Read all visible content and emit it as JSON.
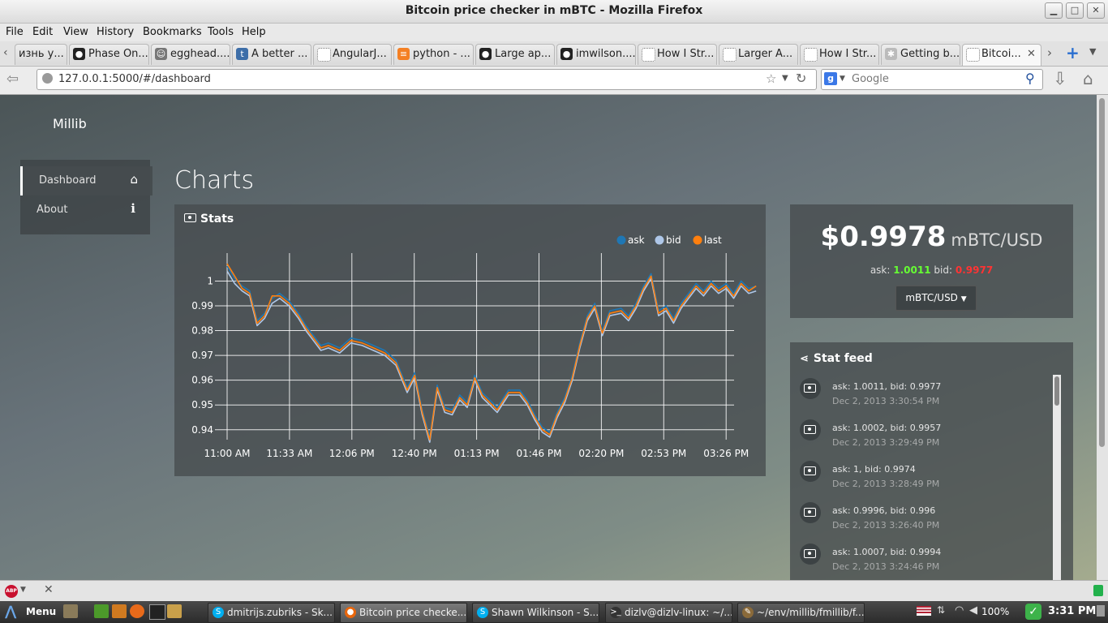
{
  "window": {
    "title": "Bitcoin price checker in mBTC - Mozilla Firefox"
  },
  "menu": [
    "File",
    "Edit",
    "View",
    "History",
    "Bookmarks",
    "Tools",
    "Help"
  ],
  "tabs": [
    {
      "label": "изнь у...",
      "icon": "generic-page-icon"
    },
    {
      "label": "Phase On...",
      "icon": "github-icon"
    },
    {
      "label": "egghead....",
      "icon": "egghead-icon"
    },
    {
      "label": "A better ...",
      "icon": "tumblr-icon"
    },
    {
      "label": "AngularJ...",
      "icon": "generic-page-icon"
    },
    {
      "label": "python - ...",
      "icon": "stackoverflow-icon"
    },
    {
      "label": "Large ap...",
      "icon": "github-icon"
    },
    {
      "label": "imwilson....",
      "icon": "github-icon"
    },
    {
      "label": "How I Str...",
      "icon": "generic-page-icon"
    },
    {
      "label": "Larger A...",
      "icon": "generic-page-icon"
    },
    {
      "label": "How I Str...",
      "icon": "generic-page-icon"
    },
    {
      "label": "Getting b...",
      "icon": "loading-icon"
    },
    {
      "label": "Bitcoi...",
      "icon": "generic-page-icon",
      "active": true
    }
  ],
  "nav": {
    "url": "127.0.0.1:5000/#/dashboard",
    "search_placeholder": "Google"
  },
  "app": {
    "brand": "Millib",
    "nav": [
      {
        "label": "Dashboard",
        "icon": "home-icon",
        "active": true
      },
      {
        "label": "About",
        "icon": "info-icon"
      }
    ],
    "page_title": "Charts",
    "stats_title": "Stats",
    "price": "$0.9978",
    "price_unit": "mBTC/USD",
    "ask_label": "ask:",
    "ask_value": "1.0011",
    "bid_label": "bid:",
    "bid_value": "0.9977",
    "currency_button": "mBTC/USD",
    "feed_title": "Stat feed",
    "feed": [
      {
        "text": "ask: 1.0011, bid: 0.9977",
        "time": "Dec 2, 2013 3:30:54 PM"
      },
      {
        "text": "ask: 1.0002, bid: 0.9957",
        "time": "Dec 2, 2013 3:29:49 PM"
      },
      {
        "text": "ask: 1, bid: 0.9974",
        "time": "Dec 2, 2013 3:28:49 PM"
      },
      {
        "text": "ask: 0.9996, bid: 0.996",
        "time": "Dec 2, 2013 3:26:40 PM"
      },
      {
        "text": "ask: 1.0007, bid: 0.9994",
        "time": "Dec 2, 2013 3:24:46 PM"
      }
    ],
    "colors": {
      "ask": "#1f77b4",
      "bid": "#aec7e8",
      "last": "#ff7f0e",
      "ask_value": "#66ff33",
      "bid_value": "#ff3333"
    }
  },
  "chart_data": {
    "type": "line",
    "title": "",
    "legend": "top-right",
    "grid": true,
    "x_ticks": [
      "11:00 AM",
      "11:33 AM",
      "12:06 PM",
      "12:40 PM",
      "01:13 PM",
      "01:46 PM",
      "02:20 PM",
      "02:53 PM",
      "03:26 PM"
    ],
    "y_ticks": [
      0.94,
      0.95,
      0.96,
      0.97,
      0.98,
      0.99,
      1
    ],
    "ylim": [
      0.936,
      1.008
    ],
    "x_minutes_from_first_tick": [
      0,
      4,
      8,
      12,
      16,
      20,
      24,
      28,
      33,
      38,
      42,
      46,
      50,
      54,
      60,
      66,
      72,
      78,
      84,
      90,
      96,
      100,
      104,
      108,
      112,
      116,
      120,
      124,
      128,
      132,
      136,
      140,
      144,
      150,
      156,
      160,
      164,
      168,
      172,
      176,
      180,
      184,
      188,
      192,
      196,
      200,
      204,
      210,
      214,
      218,
      222,
      226,
      230,
      234,
      238,
      242,
      246,
      250,
      254,
      258,
      262,
      266,
      270,
      274,
      278,
      282
    ],
    "series": [
      {
        "name": "ask",
        "values": [
          1.006,
          1.001,
          0.998,
          0.996,
          0.984,
          0.987,
          0.993,
          0.995,
          0.992,
          0.987,
          0.982,
          0.978,
          0.974,
          0.975,
          0.973,
          0.977,
          0.976,
          0.974,
          0.972,
          0.968,
          0.957,
          0.963,
          0.948,
          0.937,
          0.958,
          0.949,
          0.948,
          0.954,
          0.951,
          0.962,
          0.955,
          0.952,
          0.949,
          0.956,
          0.956,
          0.952,
          0.946,
          0.941,
          0.939,
          0.947,
          0.953,
          0.962,
          0.975,
          0.986,
          0.991,
          0.98,
          0.988,
          0.989,
          0.986,
          0.991,
          0.998,
          1.003,
          0.988,
          0.99,
          0.985,
          0.991,
          0.995,
          0.999,
          0.996,
          1.0,
          0.997,
          0.999,
          0.995,
          1.0,
          0.997,
          0.998
        ]
      },
      {
        "name": "bid",
        "values": [
          1.004,
          0.999,
          0.996,
          0.994,
          0.982,
          0.985,
          0.991,
          0.993,
          0.99,
          0.985,
          0.98,
          0.976,
          0.972,
          0.973,
          0.971,
          0.975,
          0.974,
          0.972,
          0.97,
          0.966,
          0.955,
          0.961,
          0.946,
          0.935,
          0.956,
          0.947,
          0.946,
          0.952,
          0.949,
          0.96,
          0.953,
          0.95,
          0.947,
          0.954,
          0.954,
          0.95,
          0.944,
          0.939,
          0.937,
          0.945,
          0.951,
          0.96,
          0.973,
          0.984,
          0.989,
          0.978,
          0.986,
          0.987,
          0.984,
          0.989,
          0.996,
          1.001,
          0.986,
          0.988,
          0.983,
          0.989,
          0.993,
          0.997,
          0.994,
          0.998,
          0.995,
          0.997,
          0.993,
          0.998,
          0.995,
          0.996
        ]
      },
      {
        "name": "last",
        "values": [
          1.007,
          1.002,
          0.997,
          0.995,
          0.983,
          0.986,
          0.994,
          0.994,
          0.991,
          0.986,
          0.981,
          0.977,
          0.973,
          0.974,
          0.972,
          0.976,
          0.975,
          0.973,
          0.971,
          0.967,
          0.956,
          0.962,
          0.947,
          0.936,
          0.957,
          0.948,
          0.947,
          0.953,
          0.95,
          0.961,
          0.954,
          0.951,
          0.948,
          0.955,
          0.955,
          0.951,
          0.945,
          0.94,
          0.938,
          0.946,
          0.952,
          0.961,
          0.974,
          0.985,
          0.99,
          0.979,
          0.987,
          0.988,
          0.985,
          0.99,
          0.997,
          1.002,
          0.987,
          0.989,
          0.984,
          0.99,
          0.994,
          0.998,
          0.995,
          0.999,
          0.996,
          0.998,
          0.994,
          0.999,
          0.996,
          0.998
        ]
      }
    ]
  },
  "taskbar": {
    "menu_label": "Menu",
    "tasks": [
      {
        "label": "dmitrijs.zubriks - Sk...",
        "icon": "skype-icon"
      },
      {
        "label": "Bitcoin price checke...",
        "icon": "firefox-icon",
        "active": true
      },
      {
        "label": "Shawn Wilkinson - S...",
        "icon": "skype-icon"
      },
      {
        "label": "dizlv@dizlv-linux: ~/...",
        "icon": "terminal-icon"
      },
      {
        "label": "~/env/millib/fmillib/f...",
        "icon": "editor-icon"
      }
    ],
    "volume": "100%",
    "clock": "3:31 PM"
  }
}
